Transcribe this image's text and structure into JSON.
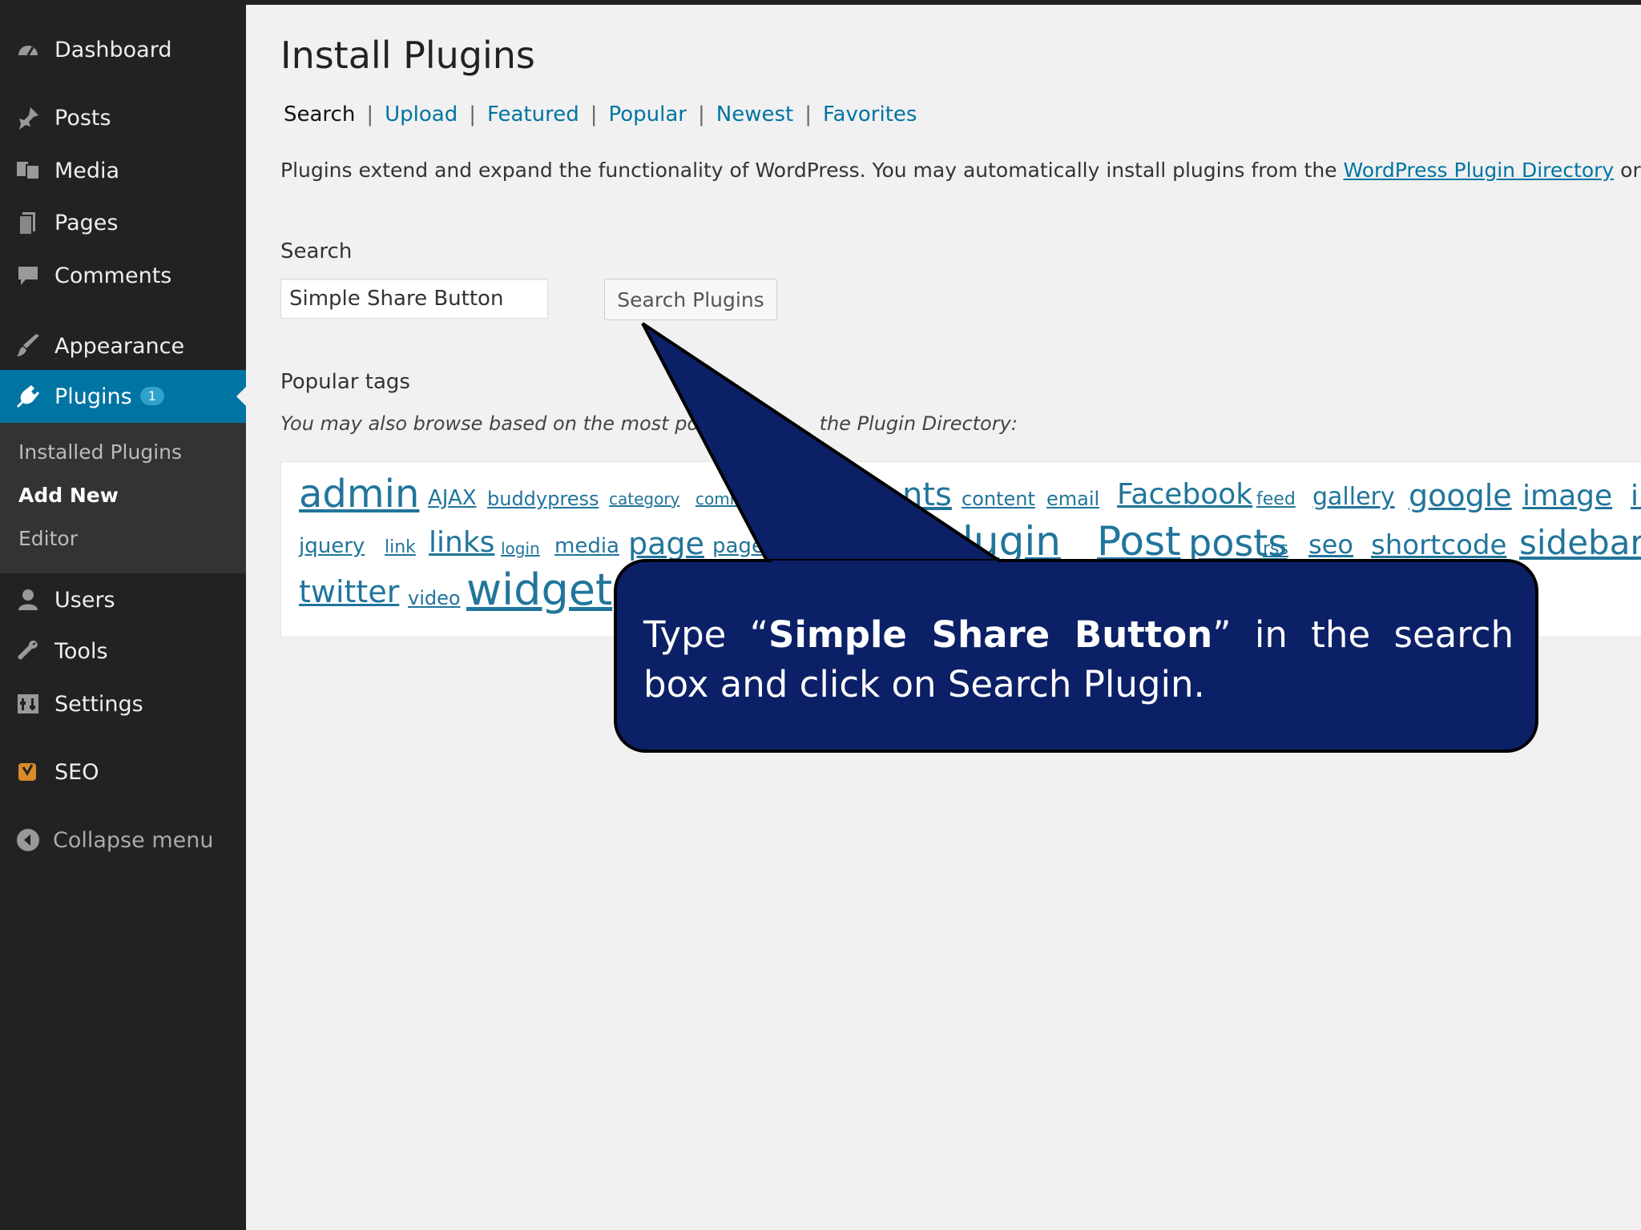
{
  "sidebar": {
    "items": [
      {
        "label": "Dashboard",
        "icon": "dashboard-icon"
      },
      {
        "label": "Posts",
        "icon": "pin-icon"
      },
      {
        "label": "Media",
        "icon": "media-icon"
      },
      {
        "label": "Pages",
        "icon": "pages-icon"
      },
      {
        "label": "Comments",
        "icon": "comment-icon"
      },
      {
        "label": "Appearance",
        "icon": "brush-icon"
      },
      {
        "label": "Plugins",
        "icon": "plug-icon",
        "badge": "1"
      },
      {
        "label": "Users",
        "icon": "user-icon"
      },
      {
        "label": "Tools",
        "icon": "wrench-icon"
      },
      {
        "label": "Settings",
        "icon": "settings-icon"
      },
      {
        "label": "SEO",
        "icon": "seo-icon"
      },
      {
        "label": "Collapse menu",
        "icon": "collapse-icon"
      }
    ],
    "submenu": [
      "Installed Plugins",
      "Add New",
      "Editor"
    ]
  },
  "main": {
    "title": "Install Plugins",
    "tabs": [
      "Search",
      "Upload",
      "Featured",
      "Popular",
      "Newest",
      "Favorites"
    ],
    "intro_text": "Plugins extend and expand the functionality of WordPress. You may automatically install plugins from the ",
    "intro_link": "WordPress Plugin Directory",
    "intro_tail": " or upload",
    "search_heading": "Search",
    "search_value": "Simple Share Button",
    "search_button": "Search Plugins",
    "popular_heading": "Popular tags",
    "popular_desc": "You may also browse based on the most popu",
    "popular_desc_tail": "the Plugin Directory:",
    "tags": [
      "admin",
      "AJAX",
      "buddypress",
      "category",
      "comm",
      "nts",
      "content",
      "email",
      "Facebook",
      "feed",
      "gallery",
      "google",
      "image",
      "ir",
      "jquery",
      "link",
      "links",
      "login",
      "media",
      "page",
      "page",
      "lugin",
      "Post",
      "posts",
      "rss",
      "seo",
      "shortcode",
      "sidebar",
      "twitter",
      "video",
      "widget"
    ]
  },
  "callout": {
    "pre": "Type “",
    "bold": "Simple Share Button",
    "post": "” in the search box and click on Search Plugin."
  },
  "colors": {
    "sidebar_bg": "#222222",
    "active_bg": "#0074a2",
    "link": "#0074a2",
    "callout_bg": "#0b2066"
  }
}
